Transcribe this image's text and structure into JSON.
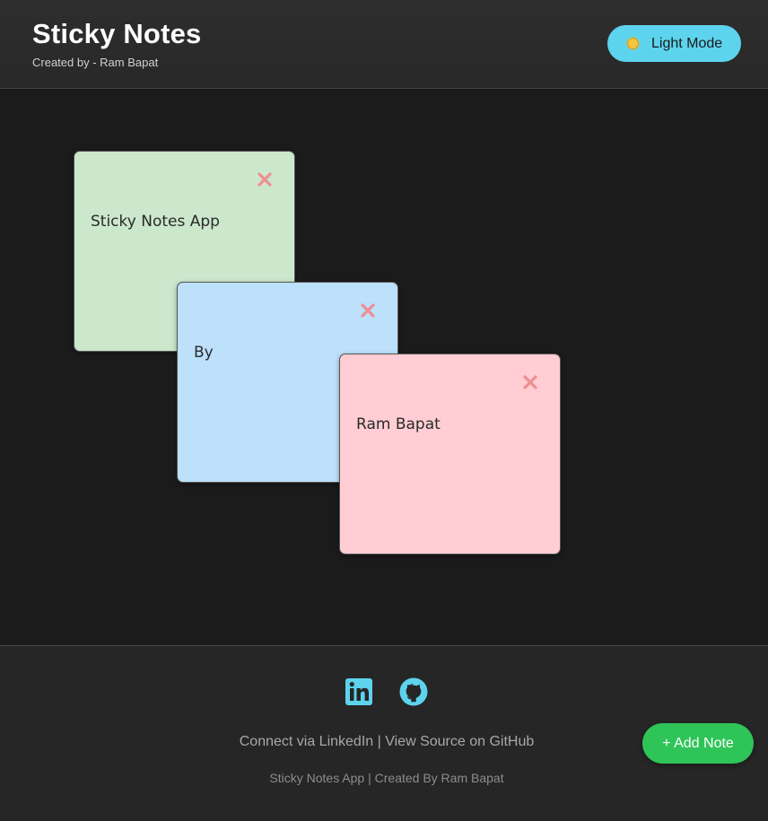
{
  "header": {
    "title": "Sticky Notes",
    "subtitle": "Created by - Ram Bapat",
    "theme_toggle": {
      "label": "Light Mode",
      "icon": "sun-icon",
      "background": "#5dd3ee"
    }
  },
  "notes": [
    {
      "text": "Sticky Notes App",
      "color": "#cbe7cc",
      "close_icon": "close-icon"
    },
    {
      "text": "By",
      "color": "#bde0fb",
      "close_icon": "close-icon"
    },
    {
      "text": "Ram Bapat",
      "color": "#ffcdd3",
      "close_icon": "close-icon"
    }
  ],
  "footer": {
    "icons": [
      "linkedin-icon",
      "github-icon"
    ],
    "link_linkedin": "Connect via LinkedIn",
    "separator": "|",
    "link_github": "View Source on GitHub",
    "credit": "Sticky Notes App | Created By Ram Bapat"
  },
  "add_note_button": {
    "label": "+ Add Note",
    "background": "#2fc458"
  },
  "colors": {
    "page_background": "#1b1b1b",
    "header_background": "#2b2b2b",
    "accent_cyan": "#5dd3ee",
    "close_icon_color": "#ee8f93"
  }
}
